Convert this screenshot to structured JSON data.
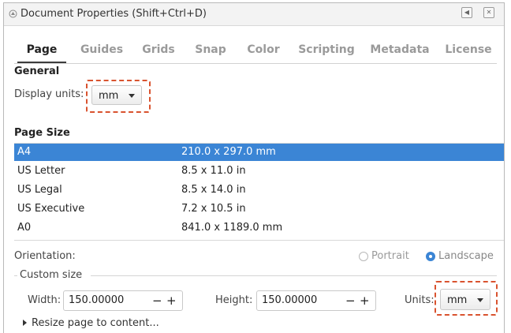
{
  "window": {
    "title": "Document Properties (Shift+Ctrl+D)"
  },
  "tabs": [
    "Page",
    "Guides",
    "Grids",
    "Snap",
    "Color",
    "Scripting",
    "Metadata",
    "License"
  ],
  "general": {
    "heading": "General",
    "display_units_label": "Display units:",
    "display_units_value": "mm"
  },
  "page_size": {
    "heading": "Page Size",
    "rows": [
      {
        "name": "A4",
        "size": "210.0 x 297.0 mm",
        "selected": true
      },
      {
        "name": "US Letter",
        "size": "8.5 x 11.0 in"
      },
      {
        "name": "US Legal",
        "size": "8.5 x 14.0 in"
      },
      {
        "name": "US Executive",
        "size": "7.2 x 10.5 in"
      },
      {
        "name": "A0",
        "size": "841.0 x 1189.0 mm"
      }
    ]
  },
  "orientation": {
    "label": "Orientation:",
    "portrait": "Portrait",
    "landscape": "Landscape",
    "selected": "Landscape"
  },
  "custom_size": {
    "heading": "Custom size",
    "width_label": "Width:",
    "width_value": "150.00000",
    "height_label": "Height:",
    "height_value": "150.00000",
    "units_label": "Units:",
    "units_value": "mm",
    "minus": "−",
    "plus": "+"
  },
  "resize": {
    "label": "Resize page to content..."
  },
  "colors": {
    "selection": "#3b85d5",
    "highlight_dash": "#d9532f"
  }
}
